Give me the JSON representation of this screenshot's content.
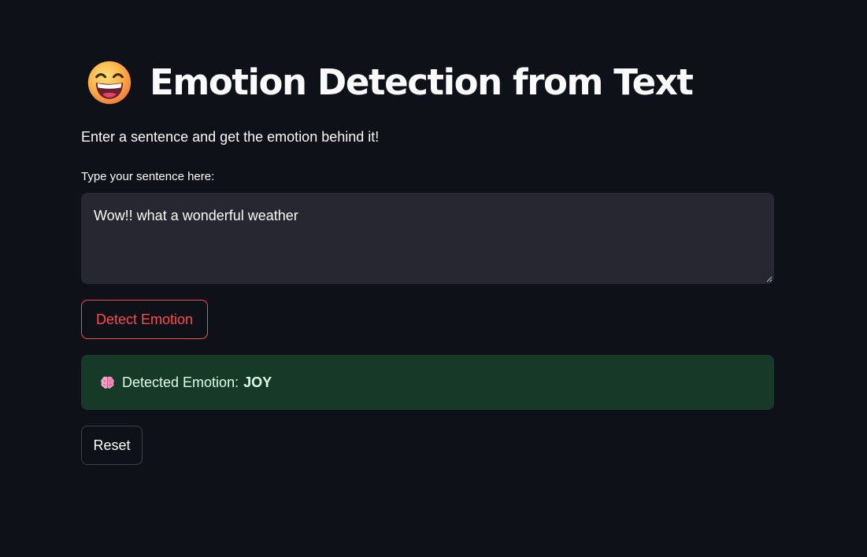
{
  "header": {
    "title_emoji_icon": "grinning-face-icon",
    "title": "Emotion Detection from Text"
  },
  "subtitle": "Enter a sentence and get the emotion behind it!",
  "input": {
    "label": "Type your sentence here:",
    "value": "Wow!! what a wonderful weather"
  },
  "buttons": {
    "detect_label": "Detect Emotion",
    "reset_label": "Reset"
  },
  "result": {
    "icon": "brain-icon",
    "prefix": "Detected Emotion:",
    "emotion": "JOY"
  },
  "colors": {
    "background": "#0e1117",
    "accent": "#ff4b4b",
    "input_bg": "#262730",
    "success_bg": "#173928",
    "success_text": "#dffde9"
  }
}
